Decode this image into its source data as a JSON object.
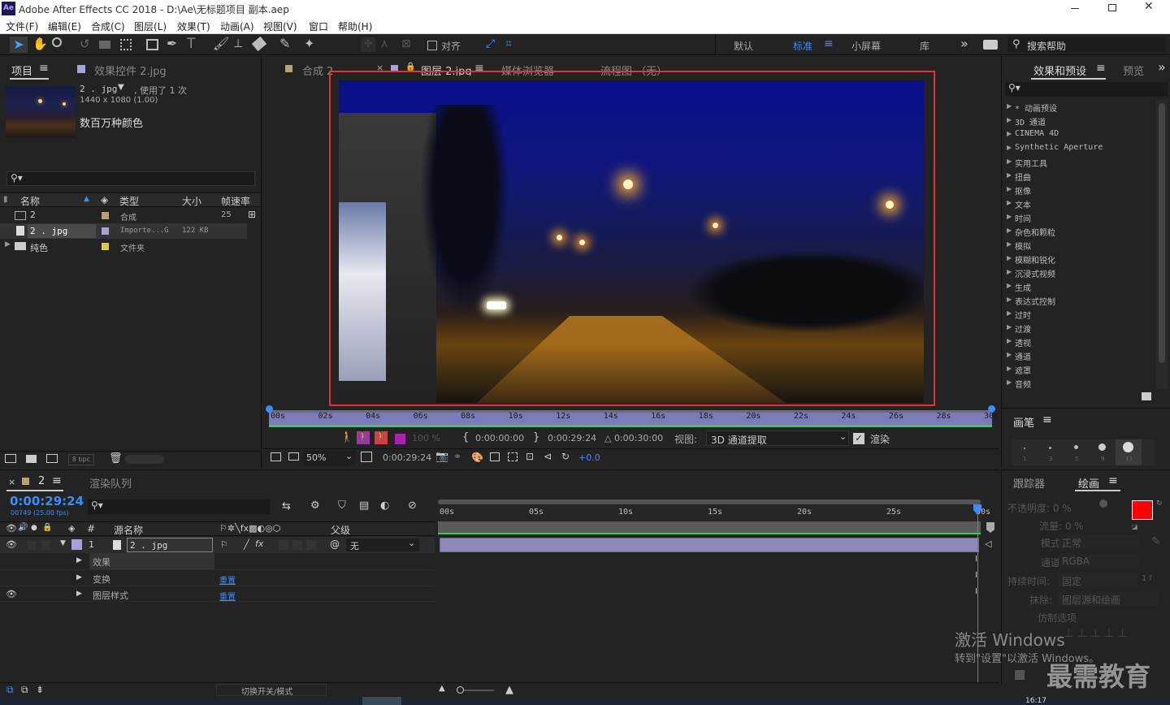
{
  "titlebar": {
    "app_icon": "Ae",
    "title": "Adobe After Effects CC 2018 - D:\\Ae\\无标题项目 副本.aep"
  },
  "menu": [
    "文件(F)",
    "编辑(E)",
    "合成(C)",
    "图层(L)",
    "效果(T)",
    "动画(A)",
    "视图(V)",
    "窗口",
    "帮助(H)"
  ],
  "toolbar": {
    "snap_label": "对齐",
    "workspaces": [
      "默认",
      "标准",
      "小屏幕",
      "库"
    ],
    "search_placeholder": "搜索帮助"
  },
  "project": {
    "tab_project": "项目",
    "tab_effects": "效果控件 2.jpg",
    "item_name": "2 . jpg",
    "item_used": ", 使用了 1 次",
    "item_dims": "1440 x 1080 (1.00)",
    "item_color": "数百万种颜色",
    "columns": {
      "name": "名称",
      "type": "类型",
      "size": "大小",
      "fps": "帧速率"
    },
    "rows": [
      {
        "name": "2",
        "type": "合成",
        "size": "",
        "fps": "25",
        "color": "#b8a272"
      },
      {
        "name": "2 . jpg",
        "type": "Importe...G",
        "size": "122 KB",
        "fps": "",
        "color": "#a3a3d6"
      },
      {
        "name": "纯色",
        "type": "文件夹",
        "size": "",
        "fps": "",
        "color": "#e0c83a"
      }
    ],
    "bpc": "8 bpc"
  },
  "viewer": {
    "tabs": [
      "合成 2",
      "图层 2.jpg",
      "媒体浏览器",
      "流程图 （无）"
    ],
    "ruler": [
      "00s",
      "02s",
      "04s",
      "06s",
      "08s",
      "10s",
      "12s",
      "14s",
      "16s",
      "18s",
      "20s",
      "22s",
      "24s",
      "26s",
      "28s",
      "30s"
    ],
    "opacity": "100 %",
    "in_time": "0:00:00:00",
    "out_time": "0:00:29:24",
    "duration": "△ 0:00:30:00",
    "view_label": "视图:",
    "view_value": "3D 通道提取",
    "render_label": "渲染",
    "zoom": "50%",
    "current_time": "0:00:29:24",
    "exposure": "+0.0"
  },
  "effects_panel": {
    "tab": "效果和预设",
    "tab2": "预览",
    "items": [
      "* 动画预设",
      "3D 通道",
      "CINEMA 4D",
      "Synthetic Aperture",
      "实用工具",
      "扭曲",
      "抠像",
      "文本",
      "时间",
      "杂色和颗粒",
      "模拟",
      "模糊和锐化",
      "沉浸式视频",
      "生成",
      "表达式控制",
      "过时",
      "过渡",
      "透视",
      "通道",
      "遮罩",
      "音频"
    ],
    "brush_tab": "画笔",
    "brush_sizes": [
      "1",
      "3",
      "5",
      "9",
      "13"
    ]
  },
  "paint": {
    "tab_tracker": "跟踪器",
    "tab_paint": "绘画",
    "opacity_label": "不透明度: 0 %",
    "flow_label": "流量: 0 %",
    "mode_label": "模式:",
    "mode_value": "正常",
    "channel_label": "通道:",
    "channel_value": "RGBA",
    "duration_label": "持续时间:",
    "duration_value": "固定",
    "duration_extra": "1 f",
    "erase_label": "抹除:",
    "erase_value": "图层源和绘画",
    "clone_label": "仿制选项"
  },
  "timeline": {
    "tab_comp": "2",
    "tab_render": "渲染队列",
    "timecode": "0:00:29:24",
    "frames": "00749 (25.00 fps)",
    "col_source": "源名称",
    "col_parent": "父级",
    "layer_num": "1",
    "layer_name": "2 . jpg",
    "parent_value": "无",
    "props": [
      {
        "name": "效果",
        "value": ""
      },
      {
        "name": "变换",
        "value": "重置"
      },
      {
        "name": "图层样式",
        "value": "重置"
      }
    ],
    "ruler": [
      "00s",
      "05s",
      "10s",
      "15s",
      "20s",
      "25s",
      "30s"
    ],
    "footer": "切换开关/模式"
  },
  "watermark": {
    "line1": "激活 Windows",
    "line2": "转到\"设置\"以激活 Windows。",
    "brand": "最需教育",
    "clock": "16:17"
  }
}
